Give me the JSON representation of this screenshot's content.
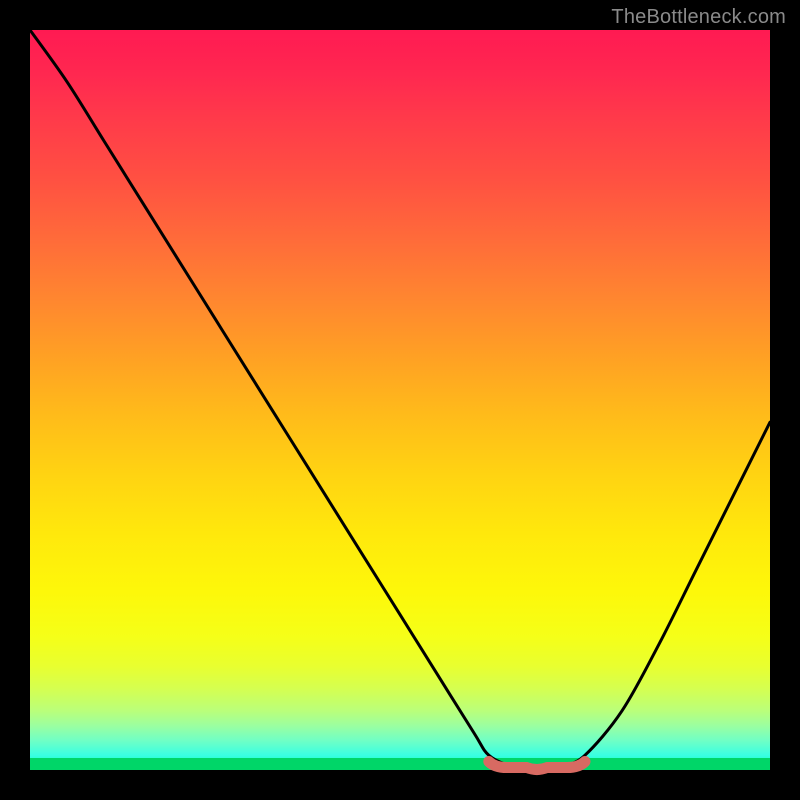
{
  "watermark": "TheBottleneck.com",
  "colors": {
    "curve_stroke": "#000000",
    "marker_stroke": "#d86a62",
    "marker_fill": "#d86a62"
  },
  "chart_data": {
    "type": "line",
    "title": "",
    "xlabel": "",
    "ylabel": "",
    "xlim": [
      0,
      100
    ],
    "ylim": [
      0,
      100
    ],
    "x": [
      0,
      5,
      10,
      15,
      20,
      25,
      30,
      35,
      40,
      45,
      50,
      55,
      60,
      62,
      65,
      68,
      70,
      72,
      75,
      80,
      85,
      90,
      95,
      100
    ],
    "values": [
      100,
      93,
      85,
      77,
      69,
      61,
      53,
      45,
      37,
      29,
      21,
      13,
      5,
      2,
      0.5,
      0,
      0,
      0.5,
      2,
      8,
      17,
      27,
      37,
      47
    ],
    "annotations": [
      {
        "text": "TheBottleneck.com",
        "position": "top-right"
      }
    ],
    "optimal_range": {
      "x_start": 62,
      "x_end": 75,
      "y": 0.6
    }
  }
}
